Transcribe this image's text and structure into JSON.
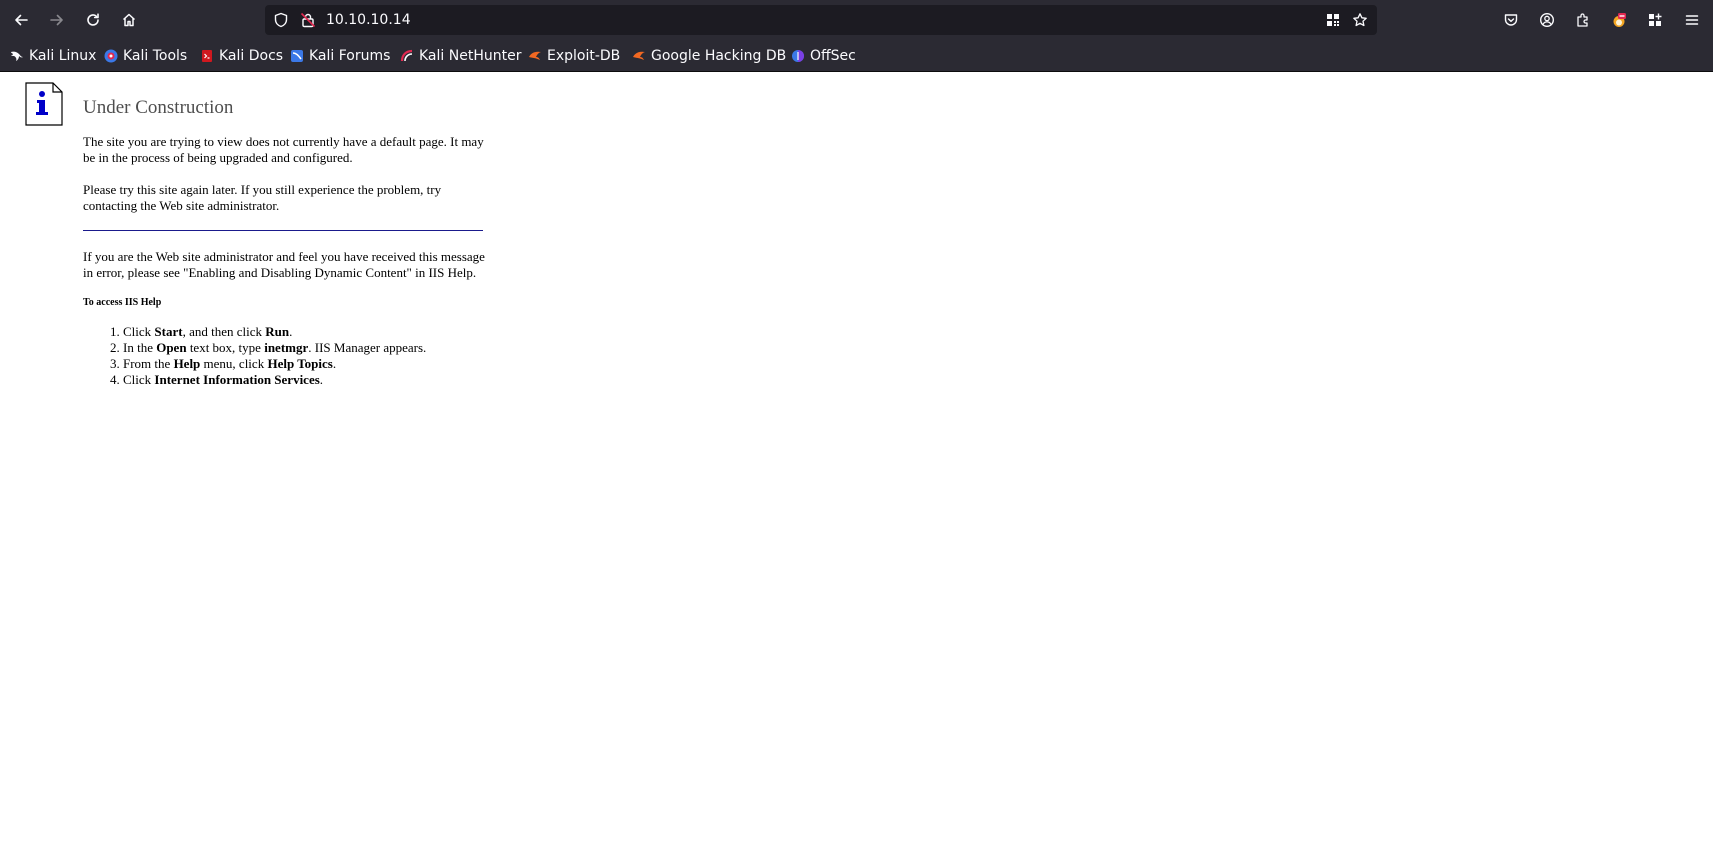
{
  "browser": {
    "url": "10.10.10.14",
    "bookmarks": [
      {
        "label": "Kali Linux",
        "icon": "kali-dragon-icon"
      },
      {
        "label": "Kali Tools",
        "icon": "kali-tools-icon"
      },
      {
        "label": "Kali Docs",
        "icon": "kali-docs-icon"
      },
      {
        "label": "Kali Forums",
        "icon": "kali-forums-icon"
      },
      {
        "label": "Kali NetHunter",
        "icon": "nethunter-icon"
      },
      {
        "label": "Exploit-DB",
        "icon": "exploit-db-icon"
      },
      {
        "label": "Google Hacking DB",
        "icon": "ghdb-icon"
      },
      {
        "label": "OffSec",
        "icon": "offsec-icon"
      }
    ]
  },
  "page": {
    "title": "Under Construction",
    "para1": "The site you are trying to view does not currently have a default page. It may be in the process of being upgraded and configured.",
    "para2": "Please try this site again later. If you still experience the problem, try contacting the Web site administrator.",
    "para3": "If you are the Web site administrator and feel you have received this message in error, please see \"Enabling and Disabling Dynamic Content\" in IIS Help.",
    "help_heading": "To access IIS Help",
    "steps": [
      {
        "t1": "Click ",
        "b1": "Start",
        "t2": ", and then click ",
        "b2": "Run",
        "t3": "."
      },
      {
        "t1": "In the ",
        "b1": "Open",
        "t2": " text box, type ",
        "b2": "inetmgr",
        "t3": ". IIS Manager appears."
      },
      {
        "t1": "From the ",
        "b1": "Help",
        "t2": " menu, click ",
        "b2": "Help Topics",
        "t3": "."
      },
      {
        "t1": "Click ",
        "b1": "Internet Information Services",
        "t2": "",
        "b2": "",
        "t3": "."
      }
    ]
  },
  "colors": {
    "chrome_bg": "#2b2a33",
    "urlbar_bg": "#1c1b22",
    "rule": "#1a1a8c",
    "info_blue": "#0000c8"
  }
}
